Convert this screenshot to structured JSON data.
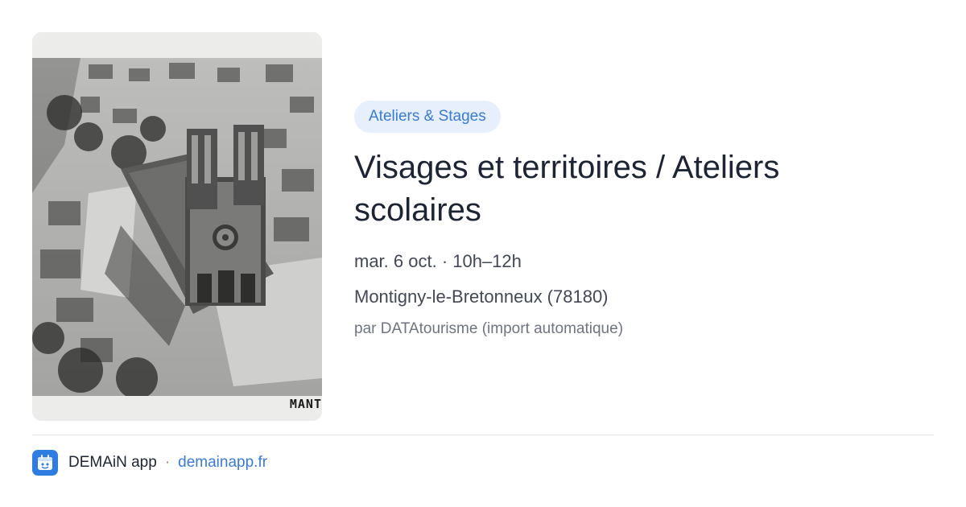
{
  "photo": {
    "caption": "MANT",
    "alt_subject": "aerial-cathedral-photo"
  },
  "event": {
    "category": "Ateliers & Stages",
    "title": "Visages et territoires / Ateliers scolaires",
    "date_time": "mar. 6 oct. · 10h–12h",
    "location": "Montigny-le-Bretonneux (78180)",
    "source": "par DATAtourisme (import automatique)"
  },
  "footer": {
    "app_name": "DEMAiN app",
    "separator": "·",
    "url": "demainapp.fr",
    "icon": "calendar-app-icon"
  },
  "colors": {
    "accent": "#3a7bd5",
    "badge_bg": "#e6effb",
    "title": "#1d2433",
    "app_icon_bg": "#2f7de1"
  }
}
